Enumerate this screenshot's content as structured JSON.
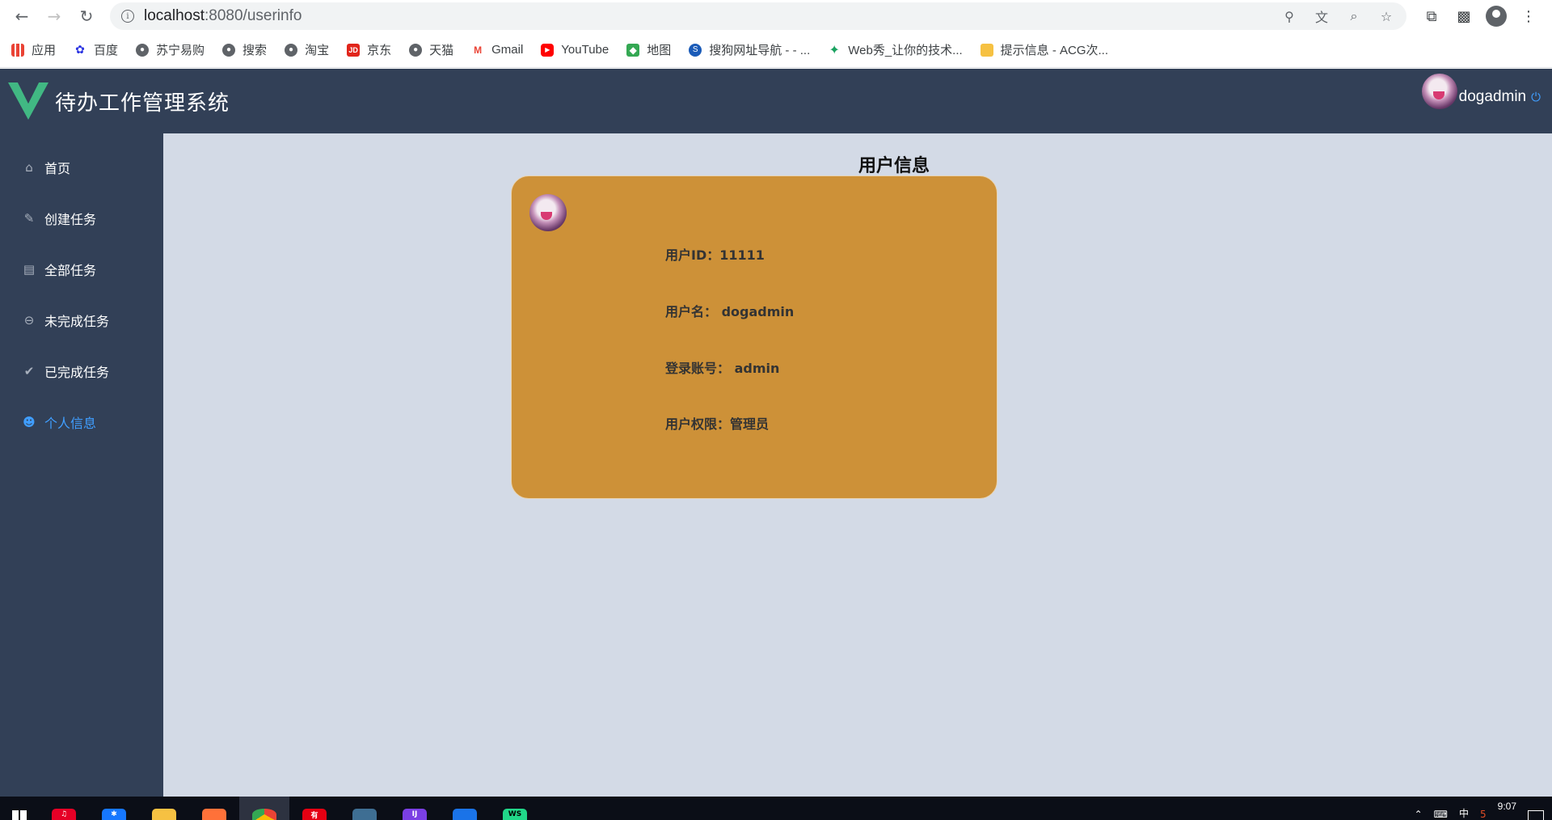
{
  "browser": {
    "url_host": "localhost",
    "url_rest": ":8080/userinfo",
    "bookmarks": [
      {
        "label": "应用",
        "icon": "apps-icon"
      },
      {
        "label": "百度",
        "icon": "baidu-icon"
      },
      {
        "label": "苏宁易购",
        "icon": "globe-icon"
      },
      {
        "label": "搜索",
        "icon": "globe-icon"
      },
      {
        "label": "淘宝",
        "icon": "globe-icon"
      },
      {
        "label": "京东",
        "icon": "jd-icon"
      },
      {
        "label": "天猫",
        "icon": "globe-icon"
      },
      {
        "label": "Gmail",
        "icon": "gmail-icon"
      },
      {
        "label": "YouTube",
        "icon": "youtube-icon"
      },
      {
        "label": "地图",
        "icon": "maps-icon"
      },
      {
        "label": "搜狗网址导航 - - ...",
        "icon": "sogou-icon"
      },
      {
        "label": "Web秀_让你的技术...",
        "icon": "webxiu-icon"
      },
      {
        "label": "提示信息 - ACG次...",
        "icon": "folder-icon"
      }
    ]
  },
  "app": {
    "title": "待办工作管理系统",
    "username": "dogadmin",
    "menu": [
      {
        "label": "首页",
        "icon": "home-icon",
        "active": false
      },
      {
        "label": "创建任务",
        "icon": "edit-icon",
        "active": false
      },
      {
        "label": "全部任务",
        "icon": "document-icon",
        "active": false
      },
      {
        "label": "未完成任务",
        "icon": "minus-circle-icon",
        "active": false
      },
      {
        "label": "已完成任务",
        "icon": "check-circle-icon",
        "active": false
      },
      {
        "label": "个人信息",
        "icon": "user-icon",
        "active": true
      }
    ],
    "page_title": "用户信息",
    "card": {
      "user_id": "用户ID：11111",
      "username": "用户名： dogadmin",
      "account": "登录账号： admin",
      "role": "用户权限：管理员"
    },
    "colors": {
      "header_bg": "#324057",
      "main_bg": "#d3dae6",
      "card_bg": "#cd9138",
      "active_menu": "#409eff"
    }
  },
  "taskbar": {
    "time": "9:07",
    "ime": "中"
  }
}
